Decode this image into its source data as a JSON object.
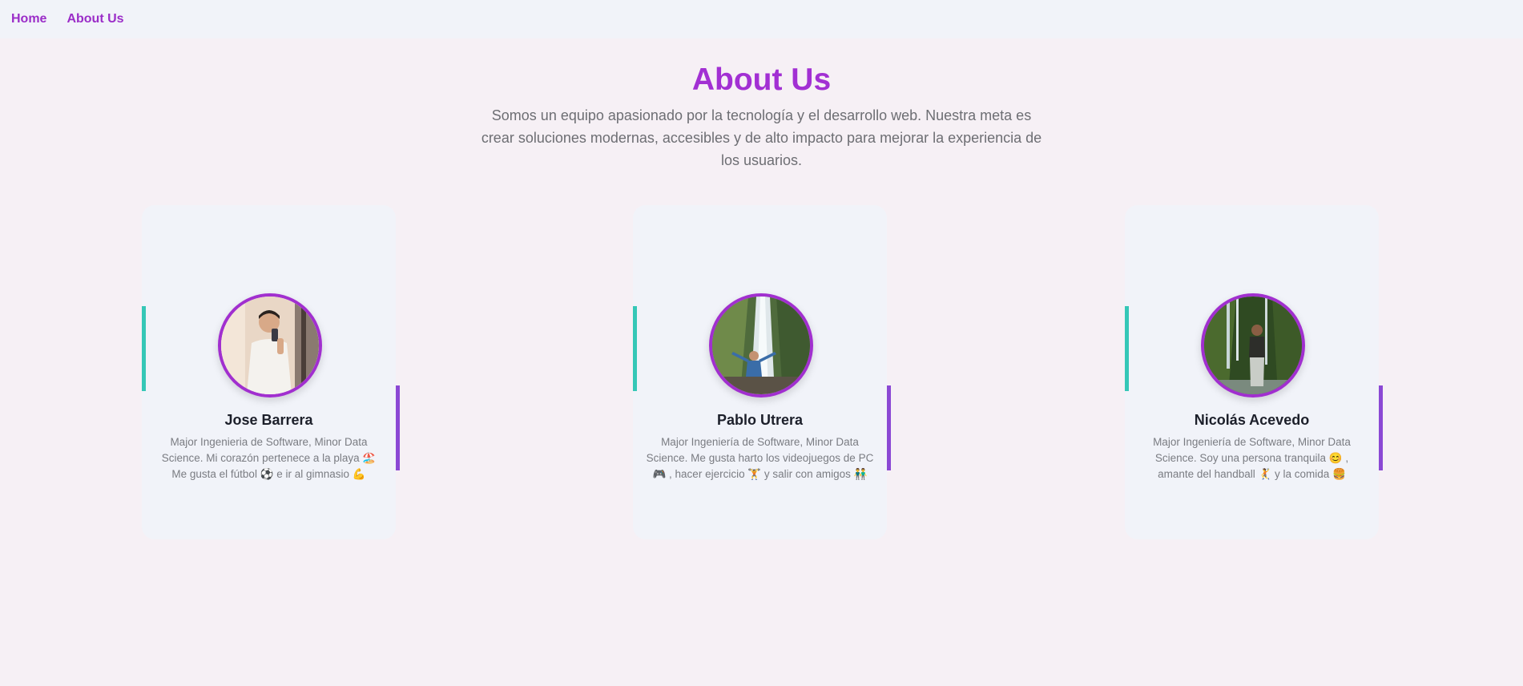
{
  "nav": {
    "home": "Home",
    "about": "About Us"
  },
  "header": {
    "title": "About Us",
    "intro": "Somos un equipo apasionado por la tecnología y el desarrollo web. Nuestra meta es crear soluciones modernas, accesibles y de alto impacto para mejorar la experiencia de los usuarios."
  },
  "team": [
    {
      "name": "Jose Barrera",
      "description": "Major Ingenieria de Software, Minor Data Science. Mi corazón pertenece a la playa 🏖️ Me gusta el fútbol ⚽ e ir al gimnasio 💪"
    },
    {
      "name": "Pablo Utrera",
      "description": "Major Ingeniería de Software, Minor Data Science. Me gusta harto los videojuegos de PC 🎮 , hacer ejercicio 🏋️ y salir con amigos 👬"
    },
    {
      "name": "Nicolás Acevedo",
      "description": "Major Ingeniería de Software, Minor Data Science. Soy una persona tranquila 😊 , amante del handball 🤾 y la comida 🍔"
    }
  ],
  "colors": {
    "accent": "#a230d3",
    "teal": "#35c7b7",
    "purple_bar": "#8b48d4"
  }
}
